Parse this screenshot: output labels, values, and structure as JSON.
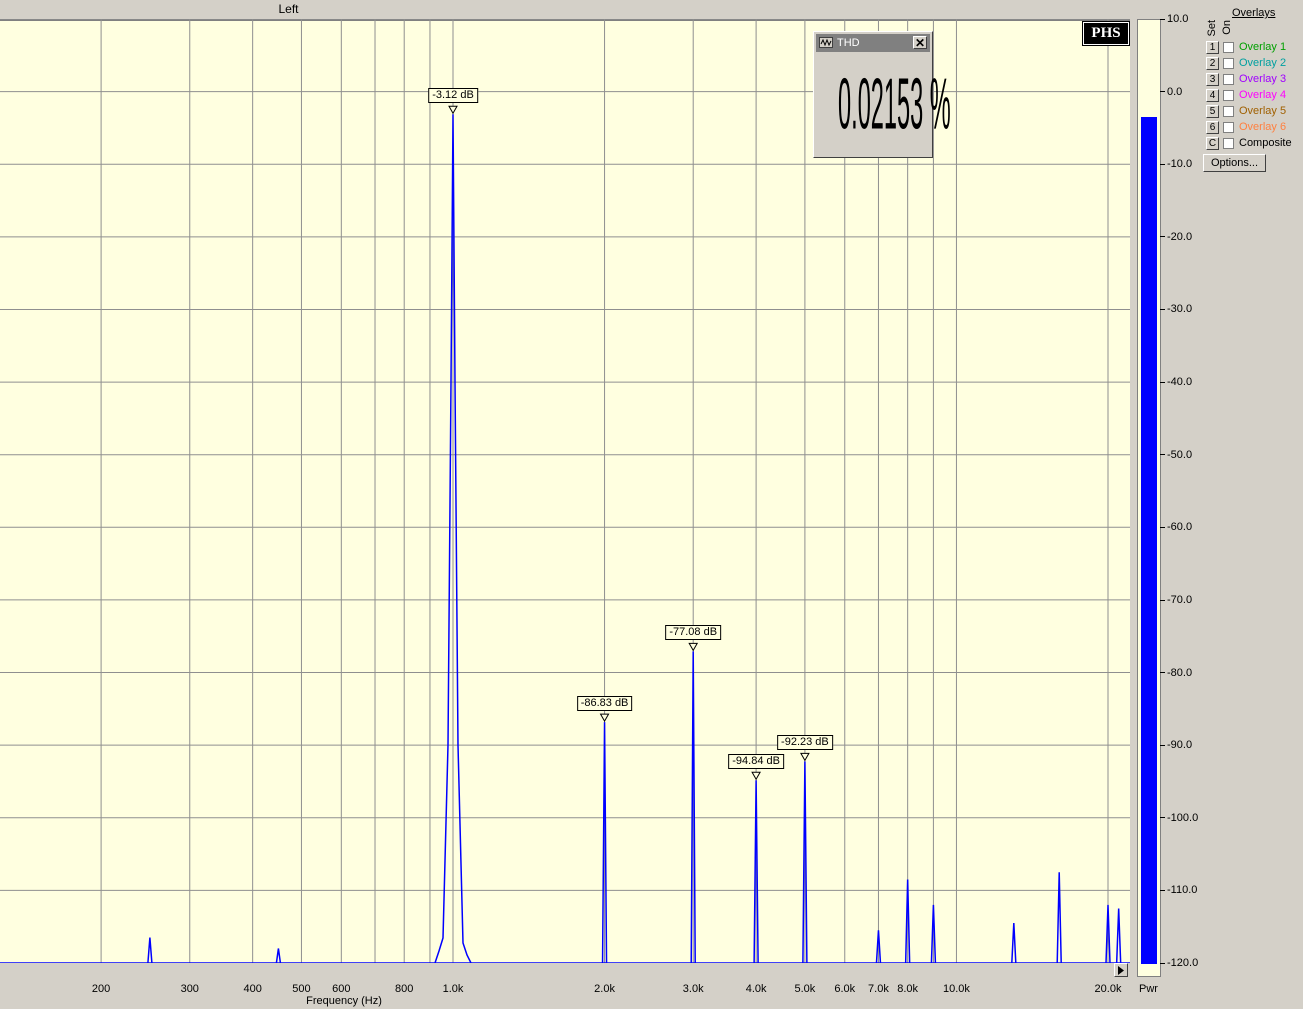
{
  "window": {
    "channel_title": "Left"
  },
  "chart_data": {
    "type": "line",
    "title": "Left",
    "xlabel": "Frequency (Hz)",
    "x_scale": "log",
    "xlim": [
      80,
      23000
    ],
    "ylim": [
      -120,
      10
    ],
    "x_ticks": [
      {
        "value": 200,
        "label": "200"
      },
      {
        "value": 300,
        "label": "300"
      },
      {
        "value": 400,
        "label": "400"
      },
      {
        "value": 500,
        "label": "500"
      },
      {
        "value": 600,
        "label": "600"
      },
      {
        "value": 800,
        "label": "800"
      },
      {
        "value": 1000,
        "label": "1.0k"
      },
      {
        "value": 2000,
        "label": "2.0k"
      },
      {
        "value": 3000,
        "label": "3.0k"
      },
      {
        "value": 4000,
        "label": "4.0k"
      },
      {
        "value": 5000,
        "label": "5.0k"
      },
      {
        "value": 6000,
        "label": "6.0k"
      },
      {
        "value": 7000,
        "label": "7.0k"
      },
      {
        "value": 8000,
        "label": "8.0k"
      },
      {
        "value": 10000,
        "label": "10.0k"
      },
      {
        "value": 20000,
        "label": "20.0k"
      }
    ],
    "y_ticks": [
      {
        "value": 10,
        "label": "10.0"
      },
      {
        "value": 0,
        "label": "0.0"
      },
      {
        "value": -10,
        "label": "-10.0"
      },
      {
        "value": -20,
        "label": "-20.0"
      },
      {
        "value": -30,
        "label": "-30.0"
      },
      {
        "value": -40,
        "label": "-40.0"
      },
      {
        "value": -50,
        "label": "-50.0"
      },
      {
        "value": -60,
        "label": "-60.0"
      },
      {
        "value": -70,
        "label": "-70.0"
      },
      {
        "value": -80,
        "label": "-80.0"
      },
      {
        "value": -90,
        "label": "-90.0"
      },
      {
        "value": -100,
        "label": "-100.0"
      },
      {
        "value": -110,
        "label": "-110.0"
      },
      {
        "value": -120,
        "label": "-120.0"
      }
    ],
    "grid": true,
    "series_color": "#0000ff",
    "background": "#ffffe0",
    "noise_floor": -120,
    "peaks": [
      {
        "x": 100,
        "y": -113.5
      },
      {
        "x": 250,
        "y": -116.5
      },
      {
        "x": 450,
        "y": -118
      },
      {
        "x": 1000,
        "y": -3.12,
        "label": "-3.12 dB"
      },
      {
        "x": 2000,
        "y": -86.83,
        "label": "-86.83 dB"
      },
      {
        "x": 3000,
        "y": -77.08,
        "label": "-77.08 dB"
      },
      {
        "x": 4000,
        "y": -94.84,
        "label": "-94.84 dB"
      },
      {
        "x": 5000,
        "y": -92.23,
        "label": "-92.23 dB"
      },
      {
        "x": 7000,
        "y": -115.5
      },
      {
        "x": 8000,
        "y": -108.5
      },
      {
        "x": 9000,
        "y": -112
      },
      {
        "x": 13000,
        "y": -114.5
      },
      {
        "x": 16000,
        "y": -107.5
      },
      {
        "x": 20000,
        "y": -112
      },
      {
        "x": 21000,
        "y": -112.5
      }
    ]
  },
  "meter": {
    "label": "Pwr",
    "level_db": -3.12,
    "color": "#0000ff"
  },
  "thd_panel": {
    "title": "THD",
    "value": "0.02153 %",
    "close_glyph": "✕"
  },
  "logo": {
    "text": "PHS"
  },
  "overlays": {
    "title": "Overlays",
    "set_header": "Set",
    "on_header": "On",
    "items": [
      {
        "set": "1",
        "label": "Overlay 1",
        "color": "#00a000"
      },
      {
        "set": "2",
        "label": "Overlay 2",
        "color": "#00a0a0"
      },
      {
        "set": "3",
        "label": "Overlay 3",
        "color": "#a000ff"
      },
      {
        "set": "4",
        "label": "Overlay 4",
        "color": "#ff00ff"
      },
      {
        "set": "5",
        "label": "Overlay 5",
        "color": "#a06000"
      },
      {
        "set": "6",
        "label": "Overlay 6",
        "color": "#ff8040"
      },
      {
        "set": "C",
        "label": "Composite",
        "color": "#000000"
      }
    ],
    "options_label": "Options..."
  }
}
